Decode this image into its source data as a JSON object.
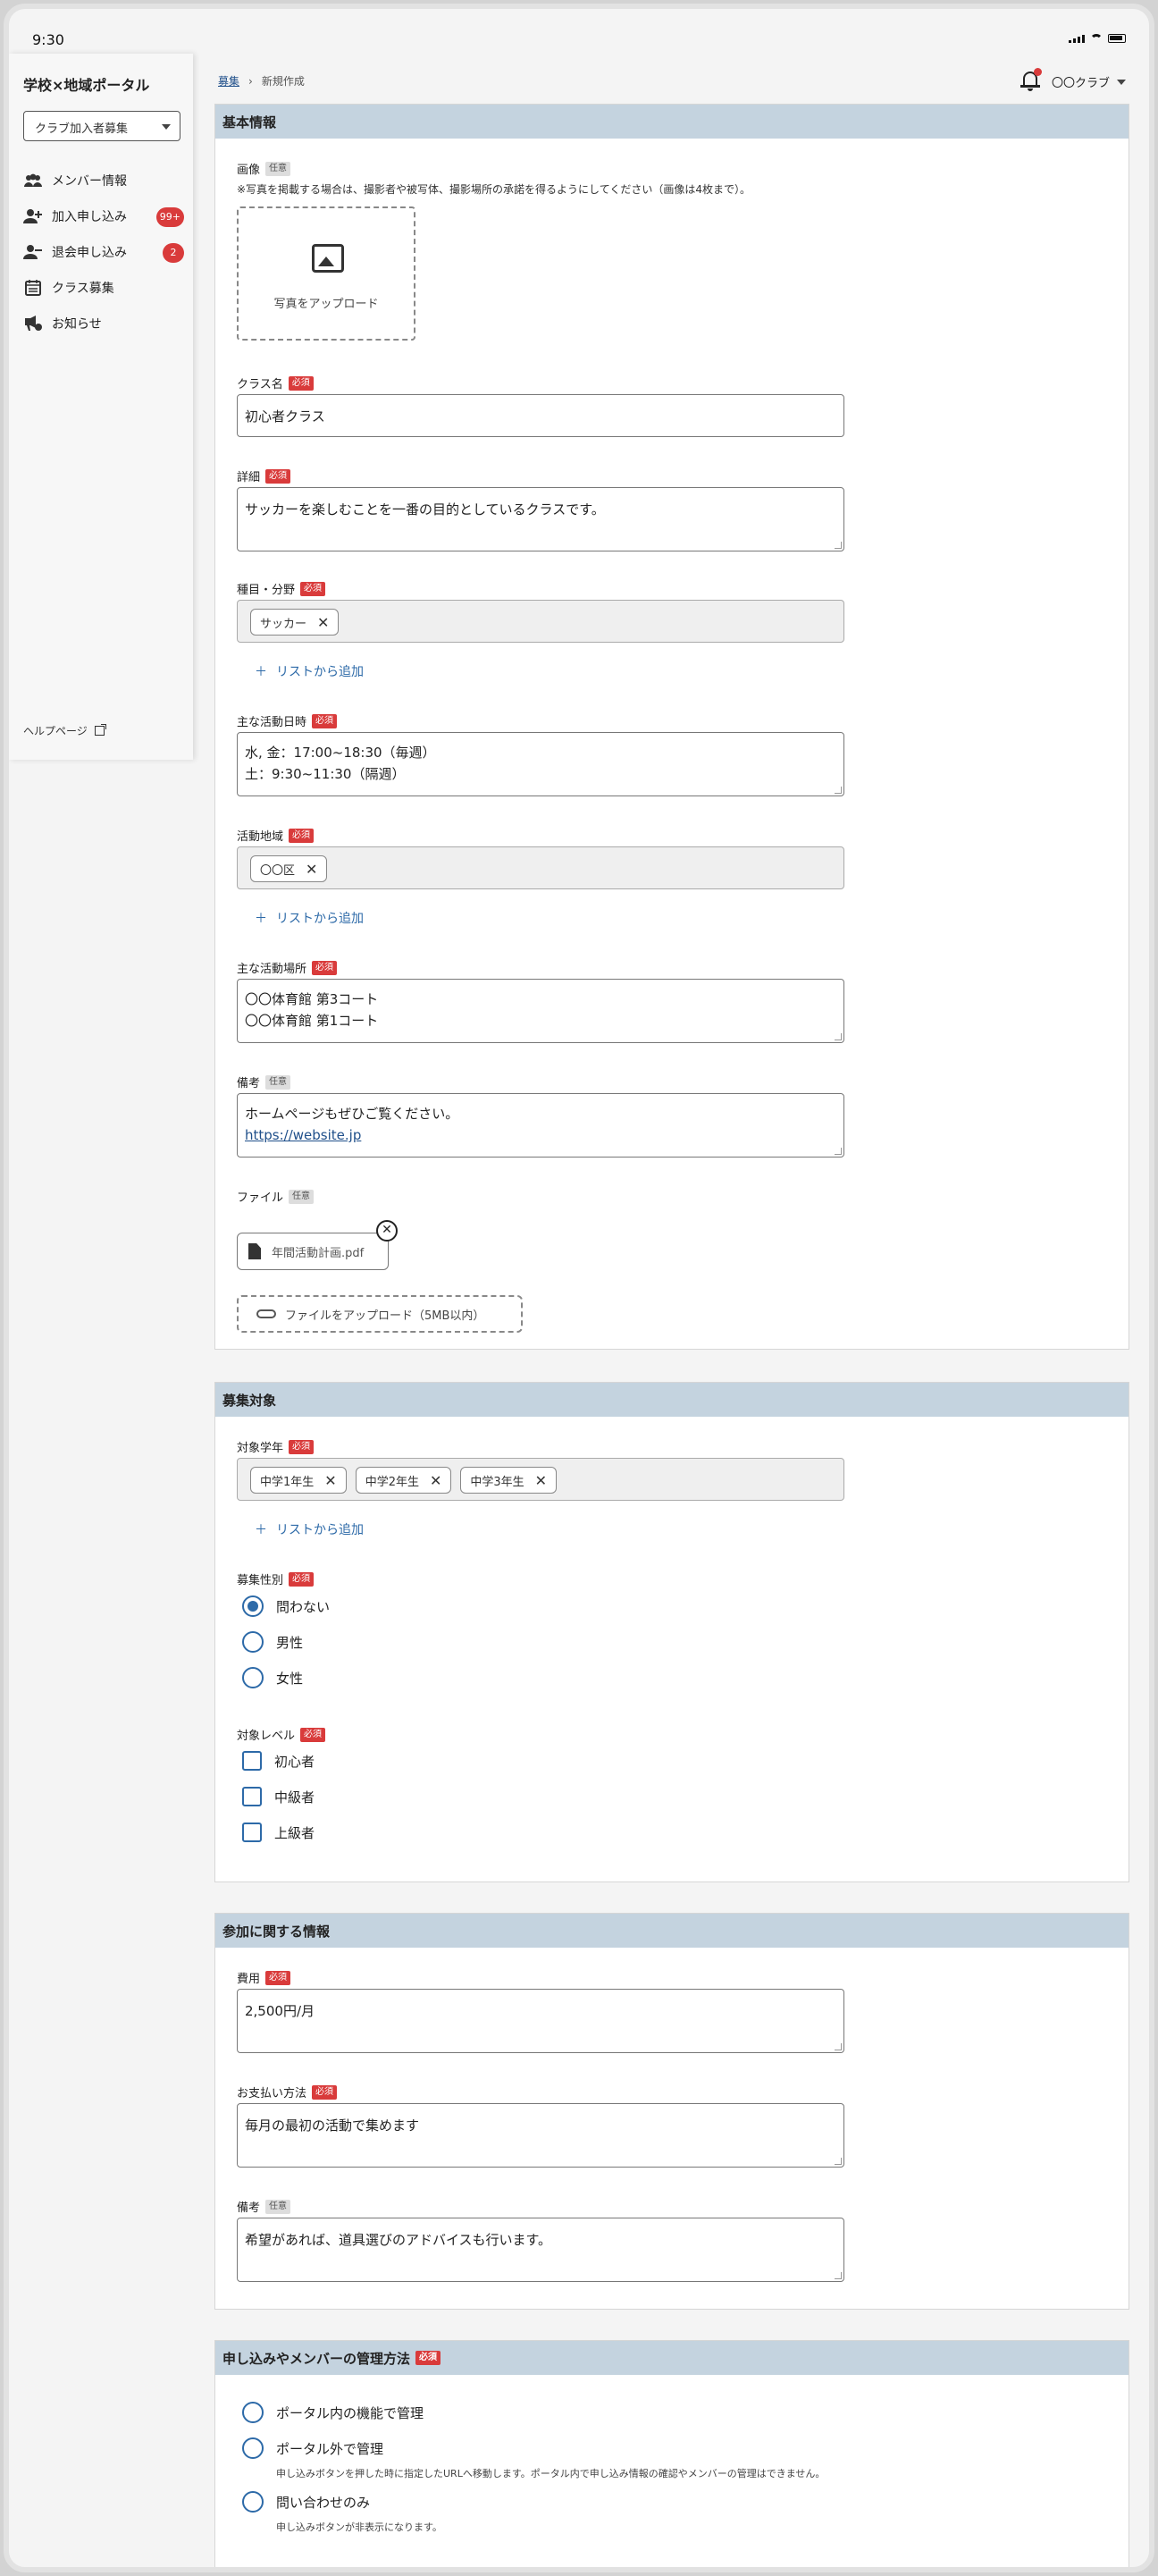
{
  "status_bar": {
    "time": "9:30"
  },
  "sidebar": {
    "brand": "学校×地域ポータル",
    "select_value": "クラブ加入者募集",
    "items": [
      {
        "label": "メンバー情報",
        "icon": "group-icon",
        "badge": ""
      },
      {
        "label": "加入申し込み",
        "icon": "person-add-icon",
        "badge": "99+"
      },
      {
        "label": "退会申し込み",
        "icon": "person-remove-icon",
        "badge": "2"
      },
      {
        "label": "クラス募集",
        "icon": "calendar-icon",
        "badge": ""
      },
      {
        "label": "お知らせ",
        "icon": "announcement-icon",
        "badge": ""
      }
    ],
    "help": "ヘルプページ"
  },
  "header": {
    "breadcrumb_link": "募集",
    "breadcrumb_sep": "›",
    "breadcrumb_current": "新規作成",
    "account": "〇〇クラブ"
  },
  "tags": {
    "required": "必須",
    "optional": "任意"
  },
  "basic": {
    "title": "基本情報",
    "image_label": "画像",
    "image_note": "※写真を掲載する場合は、撮影者や被写体、撮影場所の承諾を得るようにしてください（画像は4枚まで）。",
    "image_upload": "写真をアップロード",
    "class_name_label": "クラス名",
    "class_name_value": "初心者クラス",
    "detail_label": "詳細",
    "detail_value": "サッカーを楽しむことを一番の目的としているクラスです。",
    "sport_label": "種目・分野",
    "sport_chip": "サッカー",
    "add_from_list": "リストから追加",
    "schedule_label": "主な活動日時",
    "schedule_line1": "水, 金：17:00~18:30（毎週）",
    "schedule_line2": "土：9:30~11:30（隔週）",
    "area_label": "活動地域",
    "area_chip": "〇〇区",
    "place_label": "主な活動場所",
    "place_line1": "〇〇体育館 第3コート",
    "place_line2": "〇〇体育館 第1コート",
    "remarks_label": "備考",
    "remarks_line1": "ホームページもぜひご覧ください。",
    "remarks_link": "https://website.jp",
    "file_label": "ファイル",
    "file_name": "年間活動計画.pdf",
    "file_upload": "ファイルをアップロード（5MB以内）"
  },
  "target": {
    "title": "募集対象",
    "grade_label": "対象学年",
    "grades": [
      "中学1年生",
      "中学2年生",
      "中学3年生"
    ],
    "add_from_list": "リストから追加",
    "gender_label": "募集性別",
    "genders": [
      "問わない",
      "男性",
      "女性"
    ],
    "level_label": "対象レベル",
    "levels": [
      "初心者",
      "中級者",
      "上級者"
    ]
  },
  "participation": {
    "title": "参加に関する情報",
    "fee_label": "費用",
    "fee_value": "2,500円/月",
    "payment_label": "お支払い方法",
    "payment_value": "毎月の最初の活動で集めます",
    "remarks_label": "備考",
    "remarks_value": "希望があれば、道具選びのアドバイスも行います。"
  },
  "management": {
    "title": "申し込みやメンバーの管理方法",
    "options": [
      {
        "label": "ポータル内の機能で管理",
        "desc": ""
      },
      {
        "label": "ポータル外で管理",
        "desc": "申し込みボタンを押した時に指定したURLへ移動します。ポータル内で申し込み情報の確認やメンバーの管理はできません。"
      },
      {
        "label": "問い合わせのみ",
        "desc": "申し込みボタンが非表示になります。"
      }
    ]
  },
  "colors": {
    "accent": "#2d6aa8",
    "required": "#d93b3b",
    "section_header": "#c4d3df"
  }
}
